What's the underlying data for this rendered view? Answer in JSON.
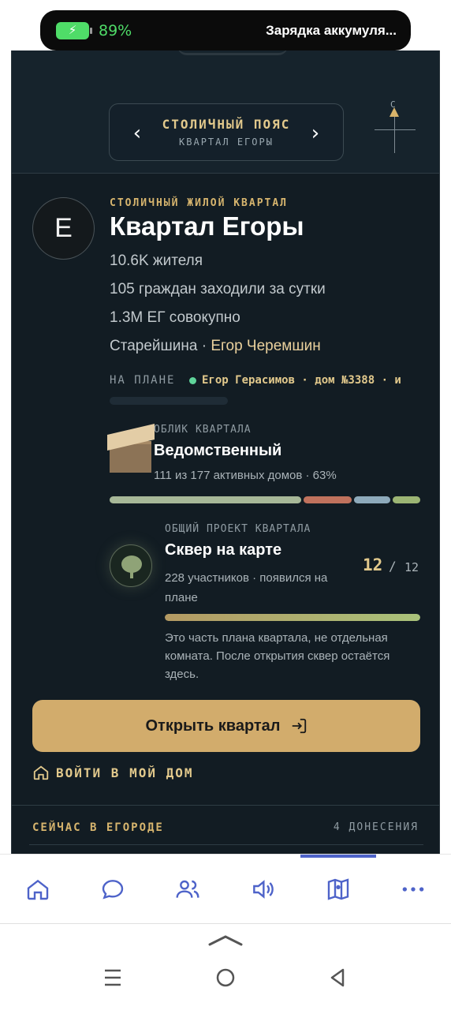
{
  "status": {
    "battery_percent": "89%",
    "battery_level": 0.89,
    "notification": "Зарядка аккумуля..."
  },
  "selector": {
    "title": "СТОЛИЧНЫЙ ПОЯС",
    "subtitle": "КВАРТАЛ ЕГОРЫ",
    "prev_icon": "chevron-left-icon",
    "next_icon": "chevron-right-icon"
  },
  "compass": {
    "north_label": "С"
  },
  "district": {
    "avatar_letter": "E",
    "category": "СТОЛИЧНЫЙ ЖИЛОЙ КВАРТАЛ",
    "name": "Квартал Егоры",
    "residents": "10.6K жителя",
    "visitors": "105 граждан заходили за сутки",
    "total": "1.3M ЕГ совокупно",
    "elder_label": "Старейшина · ",
    "elder_name": "Егор Черемшин"
  },
  "on_plan": {
    "label": "НА ПЛАНЕ",
    "ticker": "Егор Герасимов · дом №3388 · и"
  },
  "appearance": {
    "label": "ОБЛИК КВАРТАЛА",
    "title": "Ведомственный",
    "stats": "111 из 177 активных домов · 63%",
    "segments": [
      {
        "share": 0.63,
        "color": "#a7b898"
      },
      {
        "share": 0.16,
        "color": "#c0725d"
      },
      {
        "share": 0.12,
        "color": "#8eaabb"
      },
      {
        "share": 0.09,
        "color": "#9cb574"
      }
    ]
  },
  "project": {
    "label": "ОБЩИЙ ПРОЕКТ КВАРТАЛА",
    "title": "Сквер на карте",
    "meta": "228 участников · появился на плане",
    "count": "12",
    "slash": "/",
    "total": "12",
    "progress": 1.0,
    "note": "Это часть плана квартала, не отдельная комната. После открытия сквер остаётся здесь."
  },
  "actions": {
    "open_label": "Открыть квартал",
    "enter_home_label": "ВОЙТИ В МОЙ ДОМ"
  },
  "feed": {
    "title": "СЕЙЧАС В ЕГОРОДЕ",
    "count": "4 ДОНЕСЕНИЯ"
  },
  "tabs": [
    "home-icon",
    "chat-icon",
    "people-icon",
    "volume-icon",
    "map-icon",
    "more-icon"
  ],
  "colors": {
    "accent_gold": "#d2ac6c",
    "background": "#121c23",
    "active_tab": "#4e63c9"
  }
}
